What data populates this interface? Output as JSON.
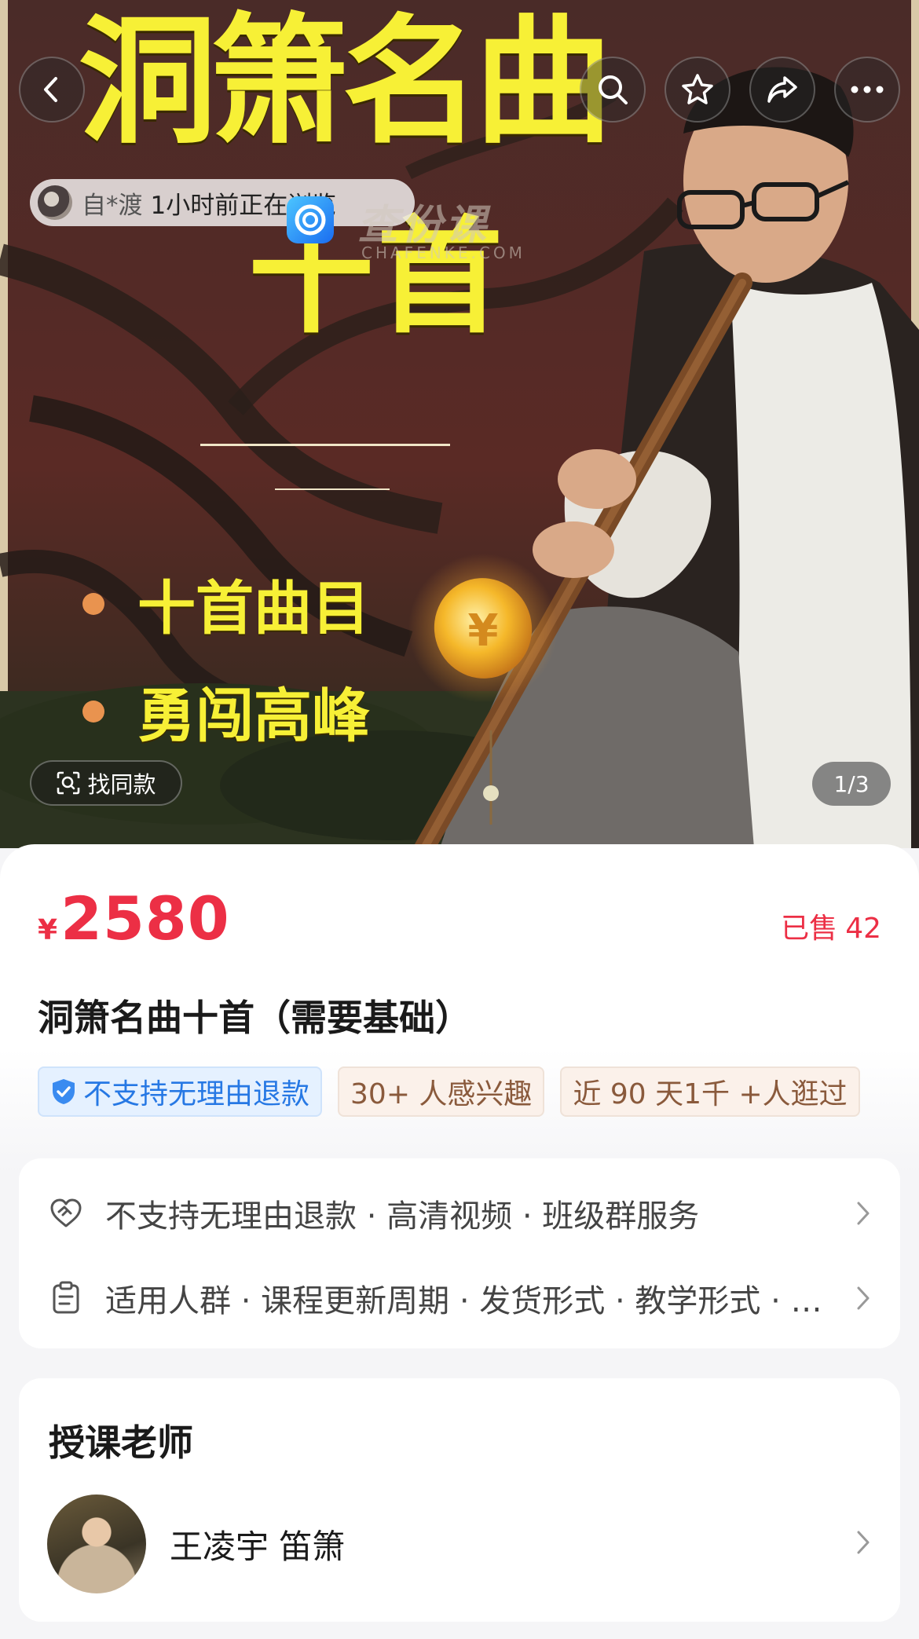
{
  "hero": {
    "title": "洞箫名曲",
    "subtitle": "十首",
    "bullets": [
      "十首曲目",
      "勇闯高峰"
    ],
    "viewer": {
      "name": "自*渡",
      "text": "1小时前正在浏览"
    },
    "watermark": {
      "text": "查份课",
      "sub": "CHAFENKE.COM"
    },
    "find_same_label": "找同款",
    "page_indicator": "1/3",
    "buttons": [
      "back-icon",
      "search-icon",
      "star-icon",
      "share-icon",
      "more-icon"
    ]
  },
  "product": {
    "currency": "¥",
    "price": "2580",
    "sold_label": "已售",
    "sold_count": "42",
    "title": "洞箫名曲十首（需要基础）",
    "tags": [
      {
        "text": "不支持无理由退款",
        "style": "blue",
        "icon": "shield-check-icon"
      },
      {
        "text": "30+ 人感兴趣",
        "style": "brown"
      },
      {
        "text": "近 90 天1千 +人逛过",
        "style": "brown"
      }
    ]
  },
  "services": [
    {
      "icon": "heart-handshake-icon",
      "text": "不支持无理由退款 · 高清视频 · 班级群服务"
    },
    {
      "icon": "clipboard-icon",
      "text": "适用人群 · 课程更新周期 · 发货形式 · 教学形式 · …"
    }
  ],
  "teacher": {
    "heading": "授课老师",
    "name": "王凌宇 笛箫"
  },
  "colors": {
    "price_red": "#ec2f45",
    "title_yellow": "#f7f036",
    "tag_blue": "#2678e4",
    "tag_brown": "#8a5a3c"
  }
}
